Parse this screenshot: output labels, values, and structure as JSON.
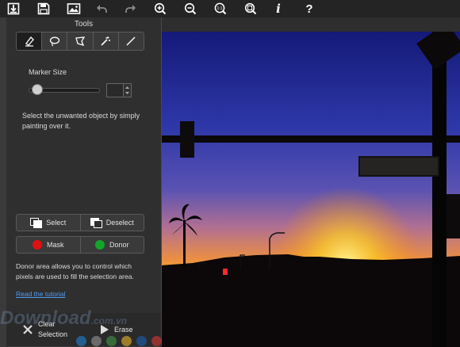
{
  "toolbar": {
    "items": [
      {
        "icon": "import-icon",
        "enabled": true
      },
      {
        "icon": "save-icon",
        "enabled": true
      },
      {
        "icon": "image-icon",
        "enabled": true
      },
      {
        "icon": "undo-icon",
        "enabled": false
      },
      {
        "icon": "redo-icon",
        "enabled": false
      },
      {
        "icon": "zoom-in-icon",
        "enabled": true
      },
      {
        "icon": "zoom-out-icon",
        "enabled": true
      },
      {
        "icon": "zoom-actual-icon",
        "enabled": true,
        "text": "1:1"
      },
      {
        "icon": "zoom-fit-icon",
        "enabled": true
      },
      {
        "icon": "info-icon",
        "enabled": true,
        "text": "i"
      },
      {
        "icon": "help-icon",
        "enabled": true,
        "text": "?"
      }
    ]
  },
  "panel": {
    "title": "Tools",
    "tools": [
      {
        "icon": "marker-icon",
        "active": true
      },
      {
        "icon": "lasso-icon",
        "active": false
      },
      {
        "icon": "polygon-lasso-icon",
        "active": false
      },
      {
        "icon": "magic-wand-icon",
        "active": false
      },
      {
        "icon": "line-icon",
        "active": false
      }
    ],
    "marker_size_label": "Marker Size",
    "marker_size_value": "",
    "marker_size_level": 0.05,
    "instruction": "Select the unwanted object by simply painting over it.",
    "select_label": "Select",
    "deselect_label": "Deselect",
    "mask_label": "Mask",
    "donor_label": "Donor",
    "mask_color": "#e01010",
    "donor_color": "#12a52a",
    "donor_note": "Donor area allows you to control which pixels are used to fill the selection area.",
    "tutorial_link": "Read the tutorial"
  },
  "bottom": {
    "clear_label_1": "Clear",
    "clear_label_2": "Selection",
    "erase_label": "Erase"
  },
  "watermark": {
    "text": "Download",
    "suffix": ".com.vn",
    "dot_colors": [
      "#1e88e5",
      "#9e9e9e",
      "#43a047",
      "#fbc02d",
      "#1565c0",
      "#e53935"
    ]
  }
}
